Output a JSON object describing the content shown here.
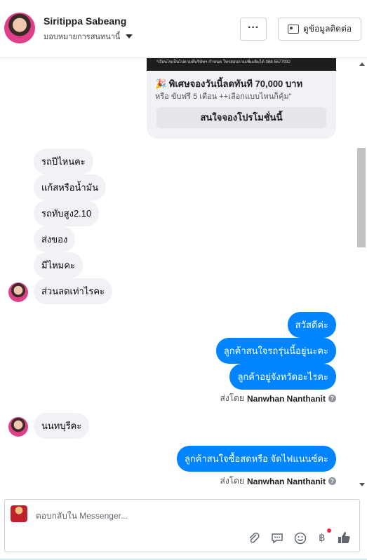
{
  "header": {
    "name": "Siritippa Sabeang",
    "assign": "มอบหมายการสนทนานี้",
    "more_label": "···",
    "contact_label": "ดูข้อมูลติดต่อ"
  },
  "promo": {
    "image_text": "*เงื่อนไขเป็นไปตามที่บริษัทฯ กำหนด โทรสอบถามเพิ่มเติมได้ 088-5577932",
    "title": "🎉 พิเศษจองวันนี้ลดทันที 70,000 บาท",
    "desc": "หรือ ขับฟรี 5 เดือน ++เลือกแบบไหนก็คุ้ม\"",
    "button": "สนใจจองโปรโมชั่นนี้"
  },
  "incoming_1": [
    "รถปีไหนคะ",
    "แก้สหรือน้ำมัน",
    "รถทับสูง2.10",
    "ส่งของ",
    "มีไหมคะ",
    "ส่วนลดเท่าไรคะ"
  ],
  "outgoing_1": [
    "สวัสดีค่ะ",
    "ลูกค้าสนใจรถรุ่นนี้อยู่นะคะ",
    "ลูกค้าอยู่จังหวัดอะไรคะ"
  ],
  "sent_by_label": "ส่งโดย",
  "sender_name": "Nanwhan Nanthanit",
  "incoming_2": [
    "นนทบุรีคะ"
  ],
  "outgoing_2": [
    "ลูกค้าสนใจซื้อสดหรือ จัดไฟแนนซ์คะ"
  ],
  "composer": {
    "placeholder": "ตอบกลับใน Messenger...",
    "icons": [
      "paperclip-icon",
      "chat-bubble-icon",
      "emoji-icon",
      "baht-icon",
      "thumbs-up-icon"
    ]
  },
  "colors": {
    "accent": "#0084ff",
    "bubble_in": "#f0f2f5"
  }
}
